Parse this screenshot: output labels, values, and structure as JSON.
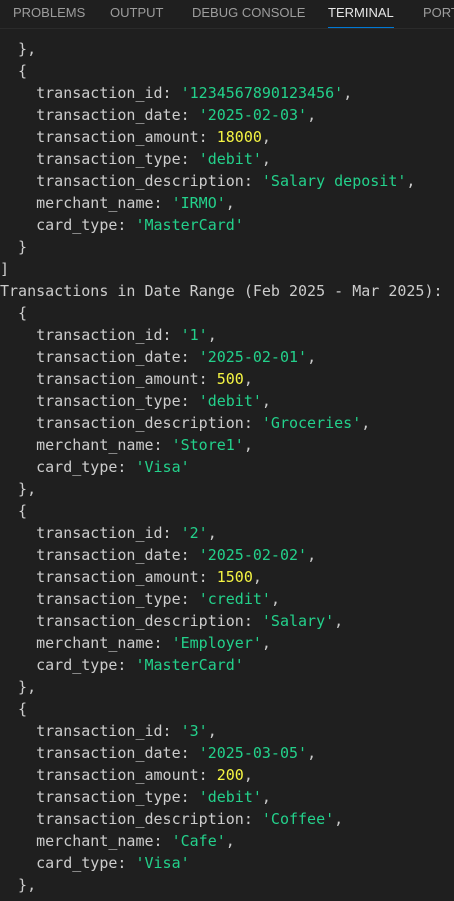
{
  "tabs": [
    {
      "label": "PROBLEMS",
      "active": false
    },
    {
      "label": "OUTPUT",
      "active": false
    },
    {
      "label": "DEBUG CONSOLE",
      "active": false
    },
    {
      "label": "TERMINAL",
      "active": true
    },
    {
      "label": "PORTS",
      "active": false
    }
  ],
  "colors": {
    "background": "#1f1f1f",
    "text": "#cccccc",
    "string": "#23d18b",
    "number": "#f5f543",
    "active_tab_underline": "#0078d4"
  },
  "terminal": {
    "lines": [
      [
        {
          "t": "  },",
          "c": "k"
        }
      ],
      [
        {
          "t": "  {",
          "c": "k"
        }
      ],
      [
        {
          "t": "    transaction_id: ",
          "c": "k"
        },
        {
          "t": "'1234567890123456'",
          "c": "s"
        },
        {
          "t": ",",
          "c": "k"
        }
      ],
      [
        {
          "t": "    transaction_date: ",
          "c": "k"
        },
        {
          "t": "'2025-02-03'",
          "c": "s"
        },
        {
          "t": ",",
          "c": "k"
        }
      ],
      [
        {
          "t": "    transaction_amount: ",
          "c": "k"
        },
        {
          "t": "18000",
          "c": "n"
        },
        {
          "t": ",",
          "c": "k"
        }
      ],
      [
        {
          "t": "    transaction_type: ",
          "c": "k"
        },
        {
          "t": "'debit'",
          "c": "s"
        },
        {
          "t": ",",
          "c": "k"
        }
      ],
      [
        {
          "t": "    transaction_description: ",
          "c": "k"
        },
        {
          "t": "'Salary deposit'",
          "c": "s"
        },
        {
          "t": ",",
          "c": "k"
        }
      ],
      [
        {
          "t": "    merchant_name: ",
          "c": "k"
        },
        {
          "t": "'IRMO'",
          "c": "s"
        },
        {
          "t": ",",
          "c": "k"
        }
      ],
      [
        {
          "t": "    card_type: ",
          "c": "k"
        },
        {
          "t": "'MasterCard'",
          "c": "s"
        }
      ],
      [
        {
          "t": "  }",
          "c": "k"
        }
      ],
      [
        {
          "t": "]",
          "c": "k"
        }
      ],
      [
        {
          "t": "Transactions in Date Range (Feb 2025 - Mar 2025):",
          "c": "k"
        }
      ],
      [
        {
          "t": "  {",
          "c": "k"
        }
      ],
      [
        {
          "t": "    transaction_id: ",
          "c": "k"
        },
        {
          "t": "'1'",
          "c": "s"
        },
        {
          "t": ",",
          "c": "k"
        }
      ],
      [
        {
          "t": "    transaction_date: ",
          "c": "k"
        },
        {
          "t": "'2025-02-01'",
          "c": "s"
        },
        {
          "t": ",",
          "c": "k"
        }
      ],
      [
        {
          "t": "    transaction_amount: ",
          "c": "k"
        },
        {
          "t": "500",
          "c": "n"
        },
        {
          "t": ",",
          "c": "k"
        }
      ],
      [
        {
          "t": "    transaction_type: ",
          "c": "k"
        },
        {
          "t": "'debit'",
          "c": "s"
        },
        {
          "t": ",",
          "c": "k"
        }
      ],
      [
        {
          "t": "    transaction_description: ",
          "c": "k"
        },
        {
          "t": "'Groceries'",
          "c": "s"
        },
        {
          "t": ",",
          "c": "k"
        }
      ],
      [
        {
          "t": "    merchant_name: ",
          "c": "k"
        },
        {
          "t": "'Store1'",
          "c": "s"
        },
        {
          "t": ",",
          "c": "k"
        }
      ],
      [
        {
          "t": "    card_type: ",
          "c": "k"
        },
        {
          "t": "'Visa'",
          "c": "s"
        }
      ],
      [
        {
          "t": "  },",
          "c": "k"
        }
      ],
      [
        {
          "t": "  {",
          "c": "k"
        }
      ],
      [
        {
          "t": "    transaction_id: ",
          "c": "k"
        },
        {
          "t": "'2'",
          "c": "s"
        },
        {
          "t": ",",
          "c": "k"
        }
      ],
      [
        {
          "t": "    transaction_date: ",
          "c": "k"
        },
        {
          "t": "'2025-02-02'",
          "c": "s"
        },
        {
          "t": ",",
          "c": "k"
        }
      ],
      [
        {
          "t": "    transaction_amount: ",
          "c": "k"
        },
        {
          "t": "1500",
          "c": "n"
        },
        {
          "t": ",",
          "c": "k"
        }
      ],
      [
        {
          "t": "    transaction_type: ",
          "c": "k"
        },
        {
          "t": "'credit'",
          "c": "s"
        },
        {
          "t": ",",
          "c": "k"
        }
      ],
      [
        {
          "t": "    transaction_description: ",
          "c": "k"
        },
        {
          "t": "'Salary'",
          "c": "s"
        },
        {
          "t": ",",
          "c": "k"
        }
      ],
      [
        {
          "t": "    merchant_name: ",
          "c": "k"
        },
        {
          "t": "'Employer'",
          "c": "s"
        },
        {
          "t": ",",
          "c": "k"
        }
      ],
      [
        {
          "t": "    card_type: ",
          "c": "k"
        },
        {
          "t": "'MasterCard'",
          "c": "s"
        }
      ],
      [
        {
          "t": "  },",
          "c": "k"
        }
      ],
      [
        {
          "t": "  {",
          "c": "k"
        }
      ],
      [
        {
          "t": "    transaction_id: ",
          "c": "k"
        },
        {
          "t": "'3'",
          "c": "s"
        },
        {
          "t": ",",
          "c": "k"
        }
      ],
      [
        {
          "t": "    transaction_date: ",
          "c": "k"
        },
        {
          "t": "'2025-03-05'",
          "c": "s"
        },
        {
          "t": ",",
          "c": "k"
        }
      ],
      [
        {
          "t": "    transaction_amount: ",
          "c": "k"
        },
        {
          "t": "200",
          "c": "n"
        },
        {
          "t": ",",
          "c": "k"
        }
      ],
      [
        {
          "t": "    transaction_type: ",
          "c": "k"
        },
        {
          "t": "'debit'",
          "c": "s"
        },
        {
          "t": ",",
          "c": "k"
        }
      ],
      [
        {
          "t": "    transaction_description: ",
          "c": "k"
        },
        {
          "t": "'Coffee'",
          "c": "s"
        },
        {
          "t": ",",
          "c": "k"
        }
      ],
      [
        {
          "t": "    merchant_name: ",
          "c": "k"
        },
        {
          "t": "'Cafe'",
          "c": "s"
        },
        {
          "t": ",",
          "c": "k"
        }
      ],
      [
        {
          "t": "    card_type: ",
          "c": "k"
        },
        {
          "t": "'Visa'",
          "c": "s"
        }
      ],
      [
        {
          "t": "  },",
          "c": "k"
        }
      ]
    ]
  }
}
